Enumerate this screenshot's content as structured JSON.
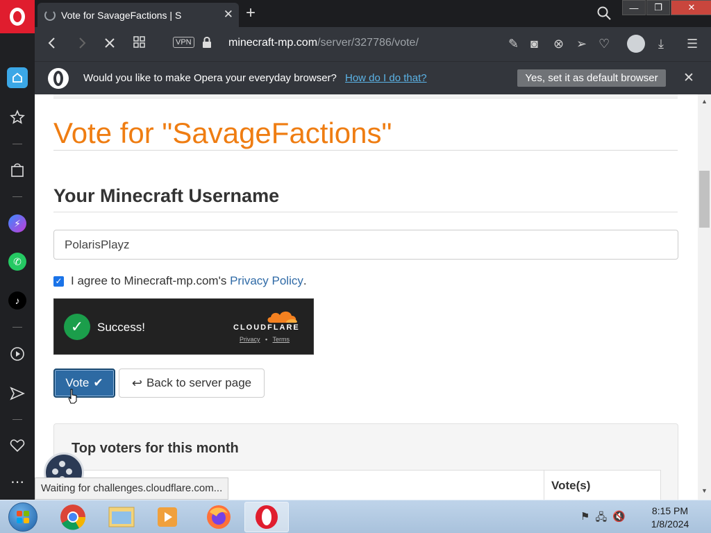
{
  "browser": {
    "tab_title": "Vote for SavageFactions | S",
    "vpn_label": "VPN",
    "url_host": "minecraft-mp.com",
    "url_path": "/server/327786/vote/",
    "window_buttons": {
      "minimize": "—",
      "restore": "❐",
      "close": "✕"
    }
  },
  "infobar": {
    "message": "Would you like to make Opera your everyday browser?",
    "link": "How do I do that?",
    "button": "Yes, set it as default browser",
    "close": "✕"
  },
  "page": {
    "title": "Vote for \"SavageFactions\"",
    "username_heading": "Your Minecraft Username",
    "username_value": "PolarisPlayz",
    "agree_text": "I agree to Minecraft-mp.com's ",
    "privacy_link": "Privacy Policy",
    "agree_period": ".",
    "captcha": {
      "status": "Success!",
      "brand": "CLOUDFLARE",
      "privacy": "Privacy",
      "dot": "•",
      "terms": "Terms"
    },
    "vote_button": "Vote",
    "back_button": "Back to server page",
    "top_voters_title": "Top voters for this month",
    "votes_column": "Vote(s)"
  },
  "status_bar": "Waiting for challenges.cloudflare.com...",
  "taskbar": {
    "time": "8:15 PM",
    "date": "1/8/2024"
  },
  "colors": {
    "opera_red": "#e01d2e",
    "title_orange": "#ef7d12",
    "vote_blue": "#2d6aa3",
    "link_blue": "#2f6aa6",
    "success_green": "#1b9e4b"
  }
}
